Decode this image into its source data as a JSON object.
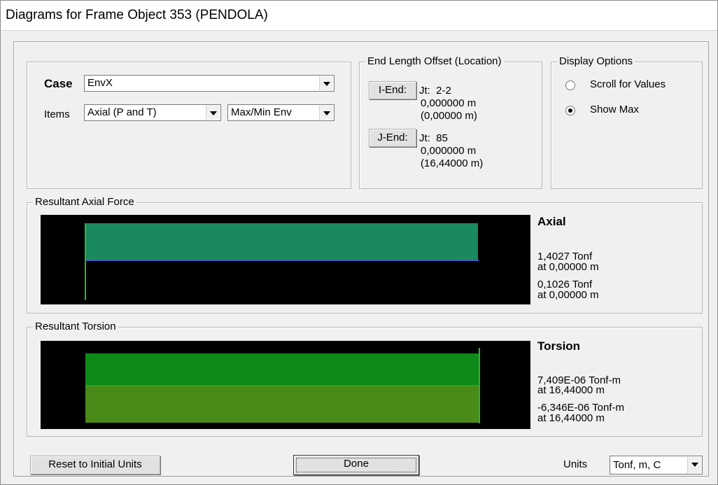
{
  "window": {
    "title": "Diagrams for Frame Object 353  (PENDOLA)"
  },
  "case": {
    "label": "Case",
    "value": "EnvX"
  },
  "items": {
    "label": "Items",
    "component": "Axial (P and T)",
    "envelope": "Max/Min Env"
  },
  "end_offset": {
    "title": "End Length Offset (Location)",
    "i_end": {
      "button": "I-End:",
      "joint": "Jt:  2-2",
      "offset": "0,000000 m",
      "location": "(0,00000 m)"
    },
    "j_end": {
      "button": "J-End:",
      "joint": "Jt:  85",
      "offset": "0,000000 m",
      "location": "(16,44000 m)"
    }
  },
  "display_options": {
    "title": "Display Options",
    "options": [
      {
        "label": "Scroll for Values",
        "selected": false
      },
      {
        "label": "Show Max",
        "selected": true
      }
    ]
  },
  "axial": {
    "group_title": "Resultant Axial Force",
    "heading": "Axial",
    "max_value": "1,4027 Tonf",
    "max_at": "at 0,00000 m",
    "min_value": "0,1026 Tonf",
    "min_at": "at 0,00000 m"
  },
  "torsion": {
    "group_title": "Resultant Torsion",
    "heading": "Torsion",
    "max_value": "7,409E-06 Tonf-m",
    "max_at": "at 16,44000 m",
    "min_value": "-6,346E-06 Tonf-m",
    "min_at": "at 16,44000 m"
  },
  "footer": {
    "reset_label": "Reset to Initial Units",
    "done_label": "Done",
    "units_label": "Units",
    "units_value": "Tonf, m, C"
  },
  "colors": {
    "diagram_bg": "#000000",
    "axial_fill": "#1a8a5e",
    "torsion_top_fill": "#0e8a18",
    "torsion_bottom_fill": "#4a8a18",
    "member_line": "#2db52d",
    "axis_line": "#3a5fbf"
  }
}
